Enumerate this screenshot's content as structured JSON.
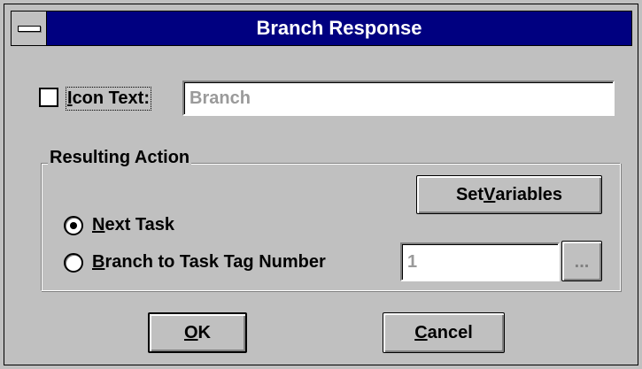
{
  "window": {
    "title": "Branch Response"
  },
  "icon_text": {
    "checkbox_checked": false,
    "label_prefix": "I",
    "label_rest": "con Text:",
    "value": "Branch"
  },
  "resulting_action": {
    "group_label": "Resulting Action",
    "set_variables_prefix": "Set ",
    "set_variables_accel": "V",
    "set_variables_rest": "ariables",
    "options": [
      {
        "accel": "N",
        "rest": "ext Task",
        "selected": true
      },
      {
        "accel": "B",
        "rest": "ranch to Task Tag Number",
        "selected": false
      }
    ],
    "tag_number_value": "1",
    "browse_label": "..."
  },
  "buttons": {
    "ok_accel": "O",
    "ok_rest": "K",
    "cancel_accel": "C",
    "cancel_rest": "ancel"
  },
  "colors": {
    "titlebar": "#000080",
    "face": "#c0c0c0",
    "disabled_text": "#9a9a9a"
  }
}
